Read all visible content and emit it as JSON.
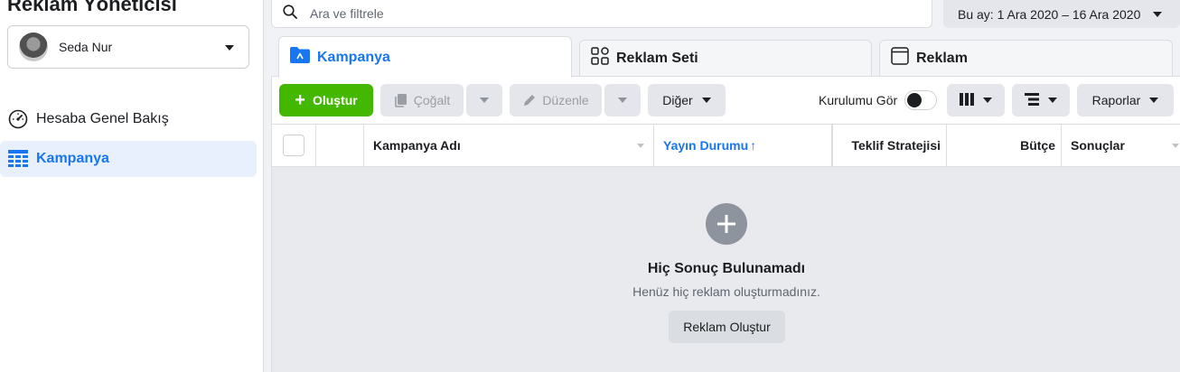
{
  "app": {
    "title": "Reklam Yöneticisi"
  },
  "account": {
    "name": "Seda Nur"
  },
  "sidebar": {
    "items": [
      {
        "label": "Hesaba Genel Bakış",
        "icon": "dashboard-gauge-icon",
        "active": false
      },
      {
        "label": "Kampanya",
        "icon": "table-grid-icon",
        "active": true
      }
    ]
  },
  "search": {
    "placeholder": "Ara ve filtrele",
    "value": ""
  },
  "date_range": {
    "label": "Bu ay: 1 Ara 2020 – 16 Ara 2020"
  },
  "tabs": [
    {
      "label": "Kampanya",
      "icon": "folder-icon",
      "active": true
    },
    {
      "label": "Reklam Seti",
      "icon": "grid-squares-icon",
      "active": false
    },
    {
      "label": "Reklam",
      "icon": "window-icon",
      "active": false
    }
  ],
  "toolbar": {
    "create_label": "Oluştur",
    "duplicate_label": "Çoğalt",
    "edit_label": "Düzenle",
    "more_label": "Diğer",
    "setup_view_label": "Kurulumu Gör",
    "setup_view_on": false,
    "reports_label": "Raporlar"
  },
  "table": {
    "columns": [
      {
        "label": "Kampanya Adı",
        "sorted": false
      },
      {
        "label": "Yayın Durumu",
        "sorted": true,
        "sort_glyph": "↑"
      },
      {
        "label": "Teklif Stratejisi",
        "sorted": false
      },
      {
        "label": "Bütçe",
        "sorted": false
      },
      {
        "label": "Sonuçlar",
        "sorted": false
      }
    ],
    "rows": []
  },
  "empty_state": {
    "title": "Hiç Sonuç Bulunamadı",
    "subtitle": "Henüz hiç reklam oluşturmadınız.",
    "button_label": "Reklam Oluştur"
  },
  "colors": {
    "accent": "#1876f2",
    "create_green": "#44b700",
    "active_nav_bg": "#e7f0fc",
    "empty_bg": "#e9eaed"
  }
}
